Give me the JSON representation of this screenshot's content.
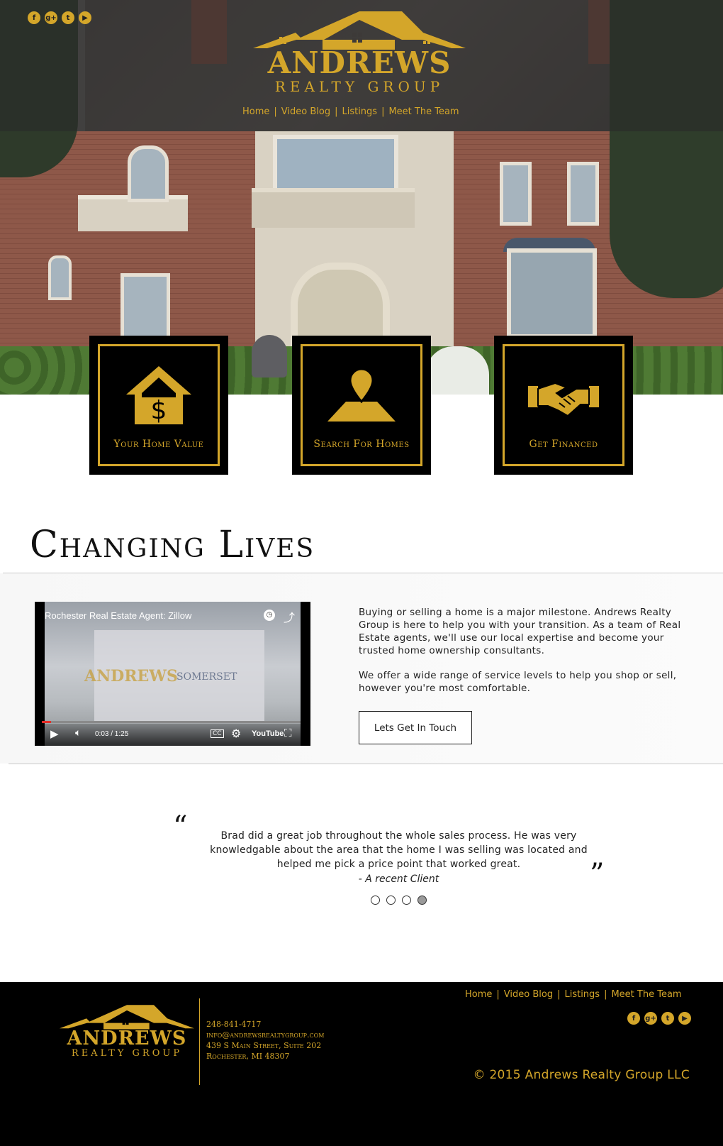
{
  "brand": {
    "name": "ANDREWS",
    "subtitle": "REALTY GROUP",
    "gold": "#d4a62a"
  },
  "social_icons": [
    "facebook-icon",
    "google-plus-icon",
    "twitter-icon",
    "youtube-icon"
  ],
  "nav": {
    "items": [
      "Home",
      "Video Blog",
      "Listings",
      "Meet The Team"
    ]
  },
  "features": [
    {
      "label": "Your Home Value",
      "icon": "house-dollar-icon"
    },
    {
      "label": "Search For Homes",
      "icon": "map-pin-icon"
    },
    {
      "label": "Get Financed",
      "icon": "handshake-icon"
    }
  ],
  "section": {
    "title": "Changing Lives",
    "paragraph1": "Buying or selling a home is a major milestone. Andrews Realty Group is here to help you with your transition. As a team of Real Estate agents, we'll use our local expertise and become your trusted home ownership consultants.",
    "paragraph2": "We offer a wide range of service levels to help you shop or sell, however you're most comfortable.",
    "button": "Lets Get In Touch"
  },
  "video": {
    "title": "Rochester Real Estate Agent: Zillow",
    "time": "0:03 / 1:25",
    "overlay_logo": "ANDREWS",
    "overlay_partner": "SOMERSET",
    "cc": "CC",
    "youtube": "YouTube",
    "progress": 0.035
  },
  "testimonial": {
    "open_quote": "“",
    "close_quote": "”",
    "text": "Brad did a great job throughout the whole sales process. He was very knowledgable about the area that the home I was selling was located and helped me pick a price point that worked great.",
    "author": "- A recent Client",
    "slides": 4,
    "active_slide": 4
  },
  "footer": {
    "phone": "248-841-4717",
    "email": "info@andrewsrealtygroup.com",
    "address1": "439 S Main Street, Suite 202",
    "address2": "Rochester, MI 48307",
    "copyright": "© 2015 Andrews Realty Group LLC"
  }
}
